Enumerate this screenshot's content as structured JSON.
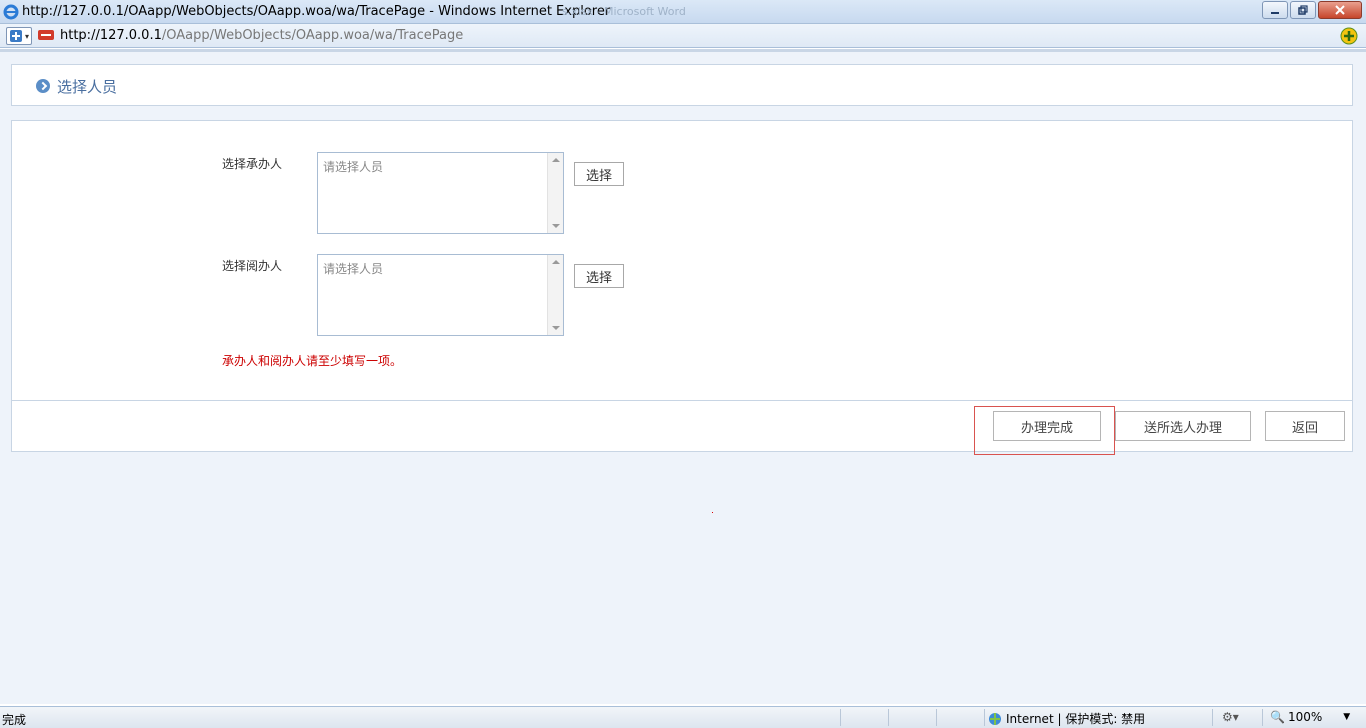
{
  "browser": {
    "title": "http://127.0.0.1/OAapp/WebObjects/OAapp.woa/wa/TracePage - Windows Internet Explorer",
    "background_window_text": "s.xlsx - Microsoft Word",
    "url_host": "http://127.0.0.1",
    "url_path": "/OAapp/WebObjects/OAapp.woa/wa/TracePage"
  },
  "page": {
    "title": "选择人员",
    "fields": [
      {
        "label": "选择承办人",
        "placeholder": "请选择人员",
        "button": "选择"
      },
      {
        "label": "选择阅办人",
        "placeholder": "请选择人员",
        "button": "选择"
      }
    ],
    "warning": "承办人和阅办人请至少填写一项。",
    "actions": {
      "finish": "办理完成",
      "send": "送所选人办理",
      "back": "返回"
    }
  },
  "status": {
    "text": "完成",
    "zone": "Internet | 保护模式: 禁用",
    "zoom": "100%"
  },
  "colors": {
    "accent": "#4a6fa0",
    "warning": "#cc0000",
    "highlight": "#d9534f"
  }
}
